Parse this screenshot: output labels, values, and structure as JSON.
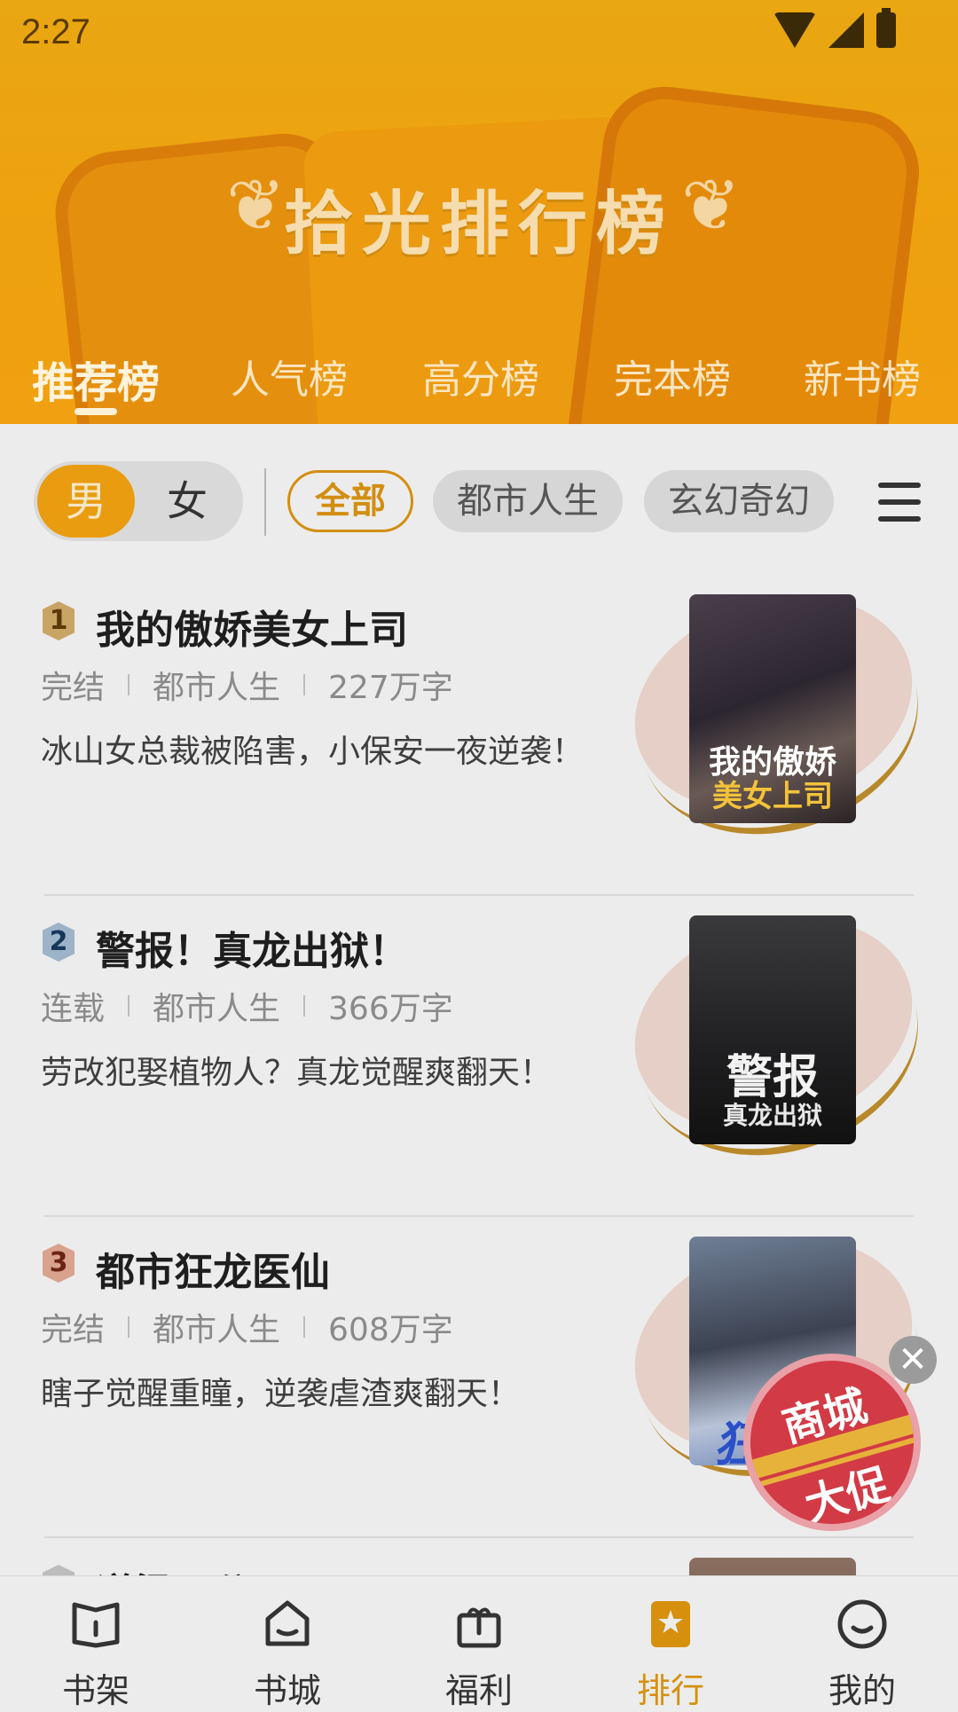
{
  "status_bar": {
    "time": "2:27"
  },
  "header": {
    "title": "拾光排行榜",
    "tabs": [
      {
        "label": "推荐榜",
        "active": true
      },
      {
        "label": "人气榜"
      },
      {
        "label": "高分榜"
      },
      {
        "label": "完本榜"
      },
      {
        "label": "新书榜"
      }
    ]
  },
  "filters": {
    "gender": {
      "male": "男",
      "female": "女",
      "selected": "男"
    },
    "categories": [
      {
        "label": "全部",
        "active": true
      },
      {
        "label": "都市人生"
      },
      {
        "label": "玄幻奇幻"
      }
    ]
  },
  "books": [
    {
      "rank": "1",
      "title": "我的傲娇美女上司",
      "status": "完结",
      "category": "都市人生",
      "words": "227万字",
      "description": "冰山女总裁被陷害，小保安一夜逆袭！",
      "cover_text_1": "我的傲娇",
      "cover_text_2": "美女上司"
    },
    {
      "rank": "2",
      "title": "警报！真龙出狱！",
      "status": "连载",
      "category": "都市人生",
      "words": "366万字",
      "description": "劳改犯娶植物人？真龙觉醒爽翻天！",
      "cover_text_1": "警报",
      "cover_text_2": "真龙出狱"
    },
    {
      "rank": "3",
      "title": "都市狂龙医仙",
      "status": "完结",
      "category": "都市人生",
      "words": "608万字",
      "description": "瞎子觉醒重瞳，逆袭虐渣爽翻天！",
      "cover_text_1": "狂",
      "cover_text_2": ""
    },
    {
      "rank": "4",
      "title": "道梁二公子",
      "status": "",
      "category": "",
      "words": "",
      "description": ""
    }
  ],
  "promo": {
    "line1": "商城",
    "line2": "大促"
  },
  "bottom_nav": [
    {
      "label": "书架",
      "icon": "bookshelf-icon"
    },
    {
      "label": "书城",
      "icon": "bookstore-icon"
    },
    {
      "label": "福利",
      "icon": "gift-icon"
    },
    {
      "label": "排行",
      "icon": "ranking-icon",
      "active": true
    },
    {
      "label": "我的",
      "icon": "profile-icon"
    }
  ],
  "colors": {
    "accent": "#e99c10",
    "active_nav": "#d6900e"
  }
}
